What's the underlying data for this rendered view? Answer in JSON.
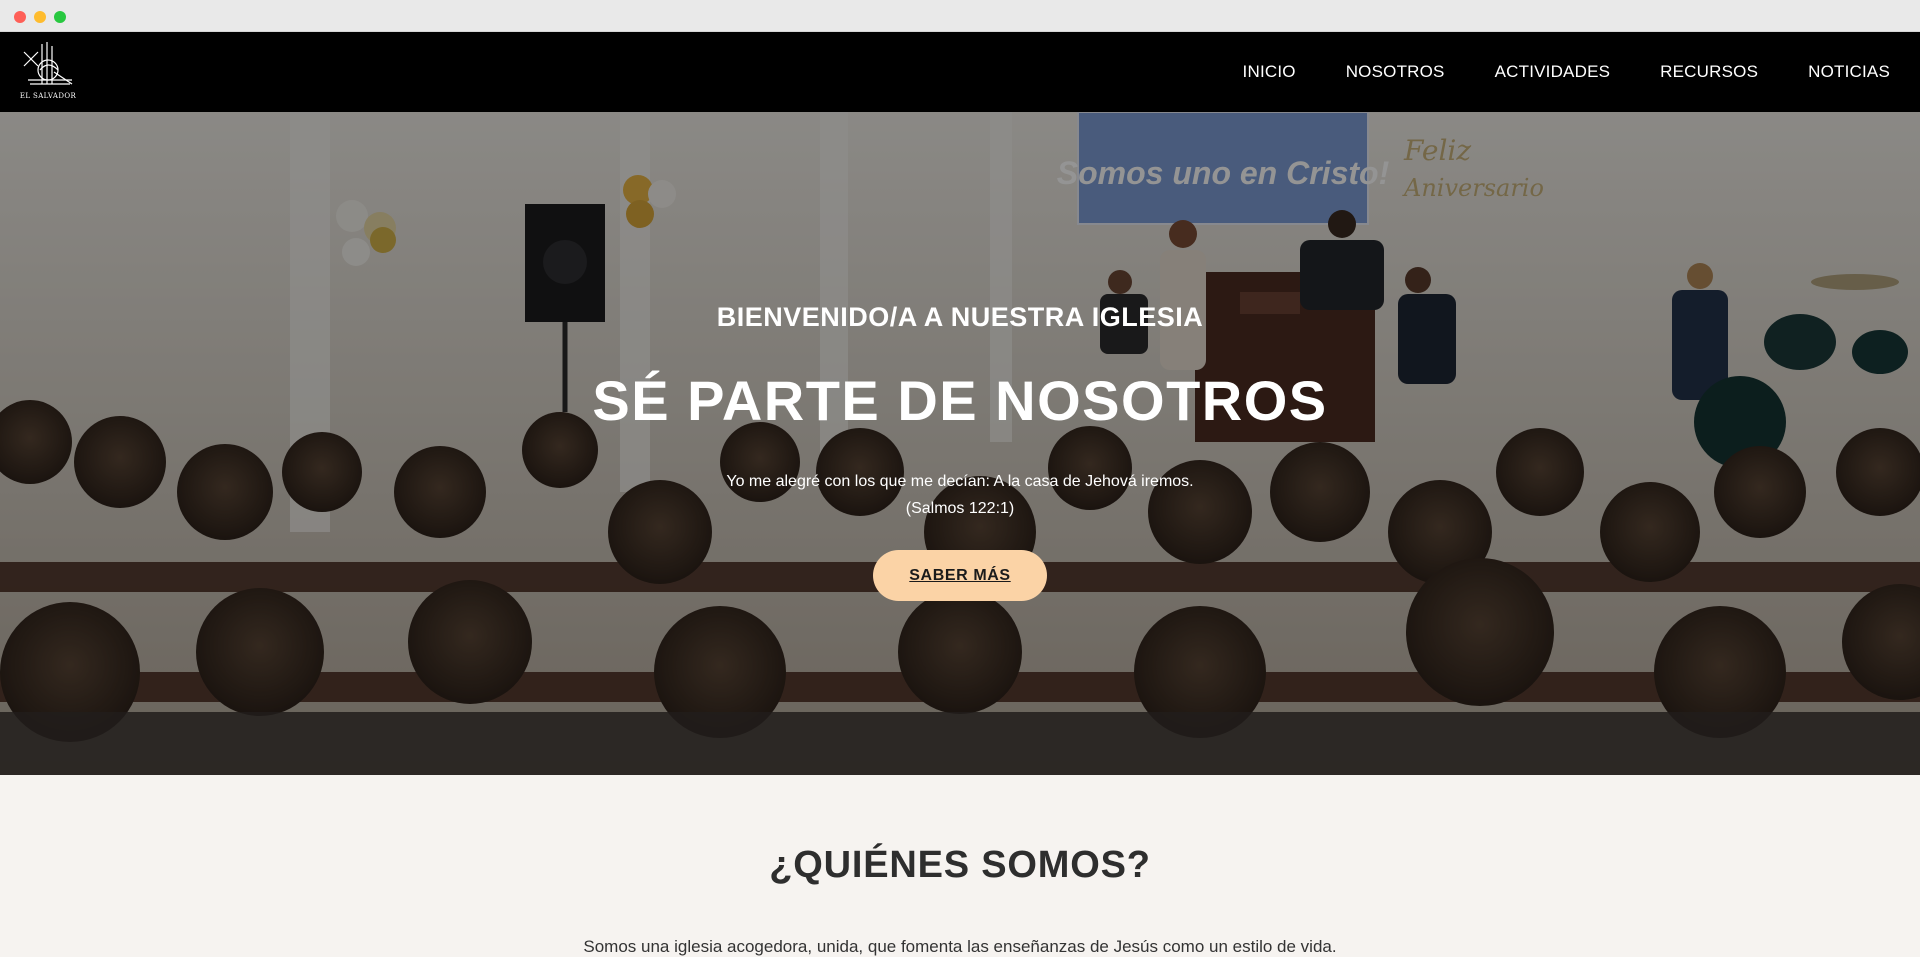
{
  "browser": {
    "controls": [
      "close",
      "minimize",
      "maximize"
    ]
  },
  "header": {
    "logo_text": "EL SALVADOR",
    "nav": [
      {
        "label": "INICIO"
      },
      {
        "label": "NOSOTROS"
      },
      {
        "label": "ACTIVIDADES"
      },
      {
        "label": "RECURSOS"
      },
      {
        "label": "NOTICIAS"
      }
    ]
  },
  "hero": {
    "kicker": "BIENVENIDO/A A NUESTRA IGLESIA",
    "title": "SÉ PARTE DE NOSOTROS",
    "verse_line1": "Yo me alegré con los que me decían: A la casa de Jehová iremos.",
    "verse_line2": "(Salmos 122:1)",
    "button_label": "SABER MÁS",
    "screen_text": "Somos uno en Cristo!",
    "wall_text_1": "Feliz",
    "wall_text_2": "Aniversario"
  },
  "about": {
    "title": "¿QUIÉNES SOMOS?",
    "text": "Somos una iglesia acogedora, unida, que fomenta las enseñanzas de Jesús como un estilo de vida."
  },
  "colors": {
    "nav_bg": "#000000",
    "button_bg": "#fbd3a6",
    "section_bg": "#f6f3f0",
    "heading": "#2e2e2e"
  }
}
